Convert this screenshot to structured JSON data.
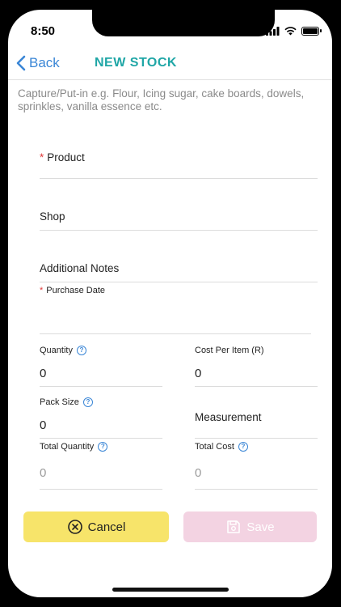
{
  "status_bar": {
    "time": "8:50"
  },
  "nav": {
    "back_label": "Back",
    "title": "NEW STOCK"
  },
  "hint": "Capture/Put-in e.g. Flour, Icing sugar, cake boards, dowels, sprinkles, vanilla essence etc.",
  "form": {
    "product": {
      "required_mark": "*",
      "label": "Product",
      "value": ""
    },
    "shop": {
      "label": "Shop",
      "value": ""
    },
    "notes": {
      "label": "Additional Notes",
      "value": ""
    },
    "purchase_date": {
      "required_mark": "*",
      "label": "Purchase Date",
      "value": ""
    },
    "quantity": {
      "label": "Quantity",
      "value": "0"
    },
    "cost_per_item": {
      "label": "Cost Per Item (R)",
      "value": "0"
    },
    "pack_size": {
      "label": "Pack Size",
      "value": "0"
    },
    "measurement": {
      "label": "Measurement",
      "value": ""
    },
    "total_quantity": {
      "label": "Total Quantity",
      "value": "0"
    },
    "total_cost": {
      "label": "Total Cost",
      "value": "0"
    }
  },
  "actions": {
    "cancel_label": "Cancel",
    "save_label": "Save"
  },
  "colors": {
    "accent": "#3a86d6",
    "title": "#1fa6a6",
    "cancel_bg": "#f7e46a",
    "save_bg": "#f3d3e2",
    "required": "#e03a3a"
  },
  "battery_level": 1.0
}
